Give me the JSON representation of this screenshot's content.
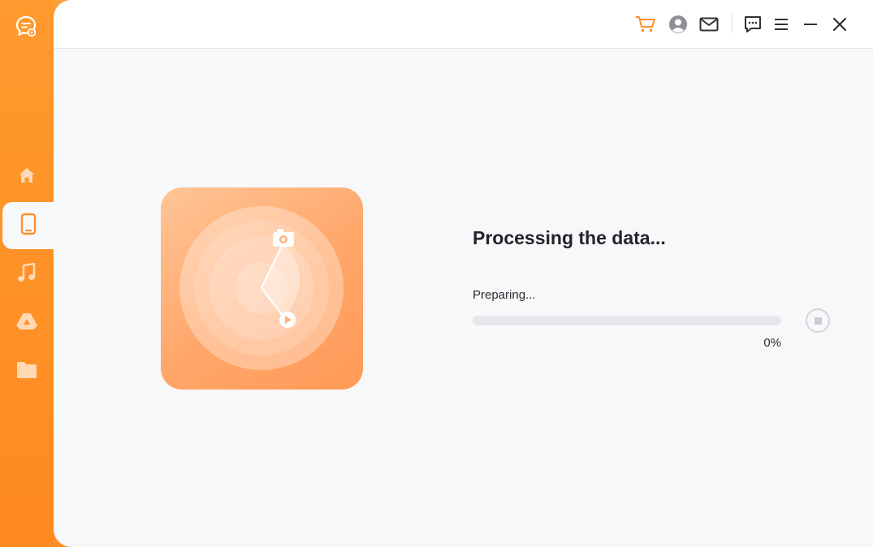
{
  "app": {
    "brand_color": "#ff8f25",
    "logo_icon": "chat-bubble-logo-icon"
  },
  "sidebar": {
    "items": [
      {
        "name": "home",
        "icon": "home-icon",
        "active": false
      },
      {
        "name": "device",
        "icon": "phone-icon",
        "active": true
      },
      {
        "name": "music",
        "icon": "music-note-icon",
        "active": false
      },
      {
        "name": "google-drive",
        "icon": "drive-icon",
        "active": false
      },
      {
        "name": "files",
        "icon": "folder-icon",
        "active": false
      }
    ]
  },
  "topbar": {
    "icons": [
      "cart-icon",
      "account-icon",
      "mail-icon",
      "feedback-icon",
      "menu-icon",
      "minimize-icon",
      "close-icon"
    ]
  },
  "main": {
    "title": "Processing the data...",
    "status": "Preparing...",
    "progress": 0,
    "percent_label": "0%"
  }
}
